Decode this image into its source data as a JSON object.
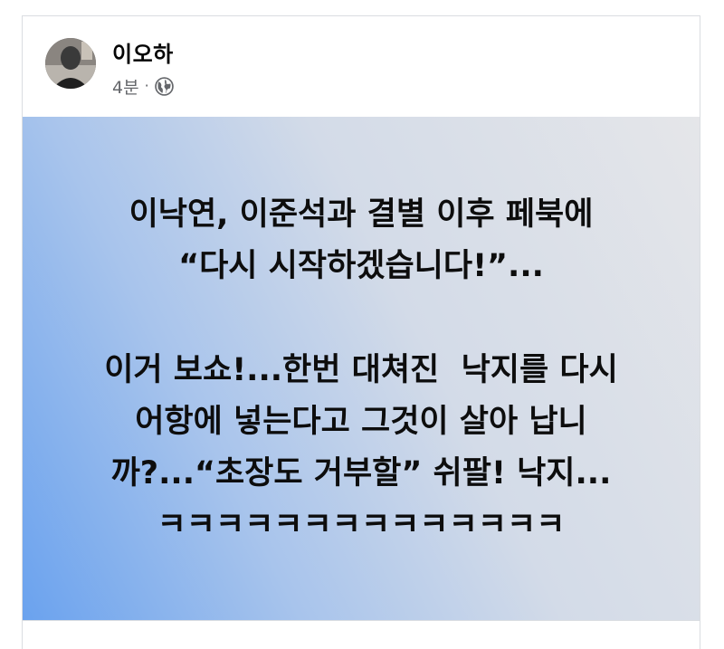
{
  "post": {
    "author_name": "이오하",
    "time": "4분",
    "separator": "·",
    "privacy_icon": "globe-icon",
    "lines_block1": [
      "이낙연, 이준석과 결별 이후 페북에",
      "“다시 시작하겠습니다!”..."
    ],
    "lines_block2": [
      "이거 보쇼!...한번 대쳐진  낙지를 다시",
      "어항에 넣는다고 그것이 살아 납니",
      "까?...“초장도 거부할” 쉬팔! 낙지...",
      "ㅋㅋㅋㅋㅋㅋㅋㅋㅋㅋㅋㅋㅋㅋ"
    ]
  },
  "colors": {
    "gradient_start": "#6aa2ee",
    "gradient_end": "#e5e6e9",
    "text": "#0d0d0d",
    "meta_text": "#65676b"
  }
}
